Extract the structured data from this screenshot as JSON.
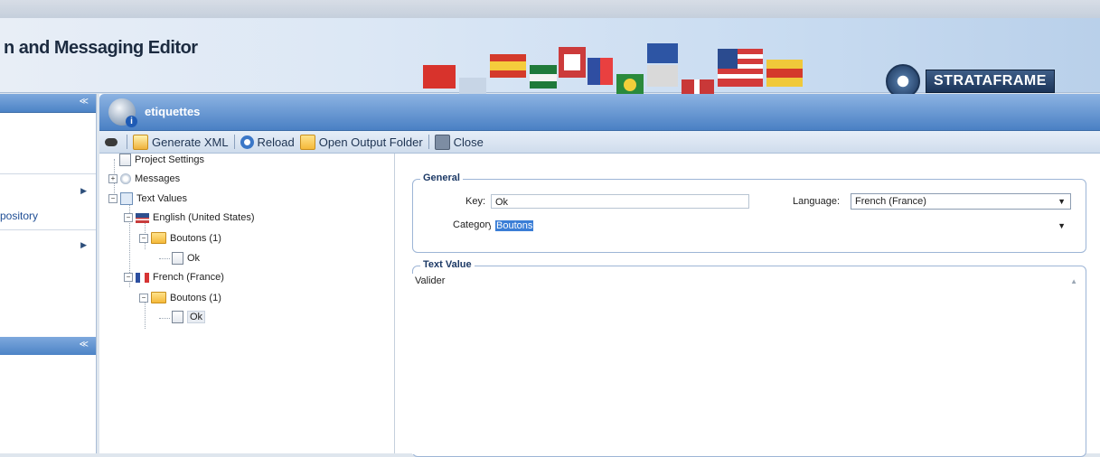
{
  "app": {
    "title": "n and Messaging Editor",
    "brand": "STRATAFRAME"
  },
  "sidebar": {
    "items": [
      {
        "label": ""
      },
      {
        "label": "pository"
      },
      {
        "label": ""
      }
    ]
  },
  "document": {
    "title": "etiquettes"
  },
  "toolbar": {
    "generate_label": "Generate XML",
    "reload_label": "Reload",
    "open_output_label": "Open Output Folder",
    "close_label": "Close"
  },
  "tree": {
    "project_settings": "Project Settings",
    "messages": "Messages",
    "text_values": "Text Values",
    "english": "English (United States)",
    "english_category": "Boutons (1)",
    "english_item": "Ok",
    "french": "French (France)",
    "french_category": "Boutons (1)",
    "french_item": "Ok"
  },
  "general": {
    "group_title": "General",
    "key_label": "Key:",
    "key_value": "Ok",
    "language_label": "Language:",
    "language_value": "French (France)",
    "category_label": "Category:",
    "category_value": "Boutons"
  },
  "text_value": {
    "group_title": "Text Value",
    "value": "Valider"
  },
  "colors": {
    "accent": "#4a80c4",
    "header_blue": "#4c83c6",
    "selection": "#3b7ed6"
  }
}
